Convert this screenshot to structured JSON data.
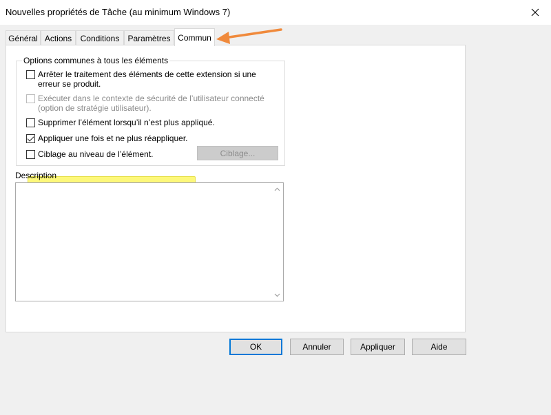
{
  "window": {
    "title": "Nouvelles propriétés de Tâche (au minimum Windows 7)",
    "close_icon": "close-icon"
  },
  "tabs": [
    {
      "label": "Général",
      "active": false
    },
    {
      "label": "Actions",
      "active": false
    },
    {
      "label": "Conditions",
      "active": false
    },
    {
      "label": "Paramètres",
      "active": false
    },
    {
      "label": "Commun",
      "active": true
    }
  ],
  "common_options": {
    "legend": "Options communes à tous les éléments",
    "options": [
      {
        "label_line1": "Arrêter le traitement des éléments de cette extension si une",
        "label_line2": "erreur se produit.",
        "checked": false,
        "enabled": true
      },
      {
        "label_line1": "Exécuter dans le contexte de sécurité de l’utilisateur connecté",
        "label_line2": "(option de stratégie utilisateur).",
        "checked": false,
        "enabled": false
      },
      {
        "label_line1": "Supprimer l’élément lorsqu’il n’est plus appliqué.",
        "checked": false,
        "enabled": true
      },
      {
        "label_line1": "Appliquer une fois et ne plus réappliquer.",
        "checked": true,
        "enabled": true,
        "highlighted": true
      },
      {
        "label_line1": "Ciblage au niveau de l’élément.",
        "checked": false,
        "enabled": true
      }
    ],
    "targeting_button": "Ciblage..."
  },
  "description": {
    "label": "Description",
    "value": ""
  },
  "buttons": {
    "ok": "OK",
    "cancel": "Annuler",
    "apply": "Appliquer",
    "help": "Aide"
  },
  "annotation": {
    "arrow_color": "#f08a3c",
    "highlight_color": "#fdf87a"
  },
  "colors": {
    "dialog_bg": "#f0f0f0",
    "panel_bg": "#ffffff",
    "default_button_border": "#0078d7"
  }
}
